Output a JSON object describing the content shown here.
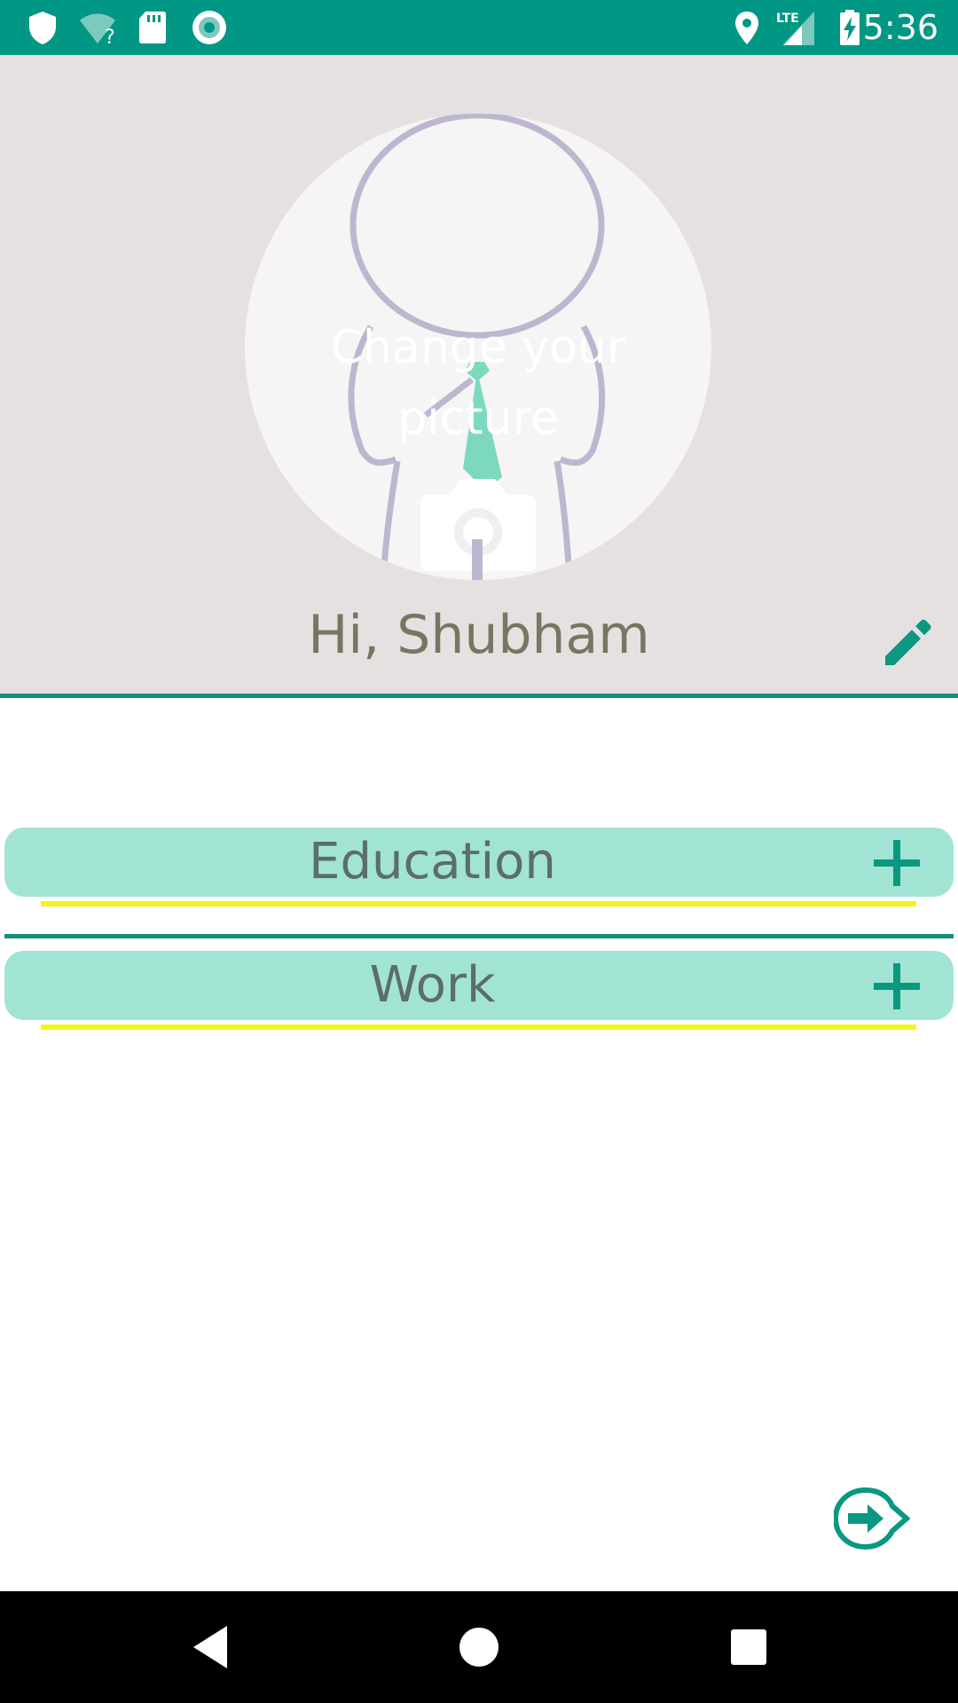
{
  "status_bar": {
    "time": "5:36",
    "icons": [
      "shield-icon",
      "wifi-unknown-icon",
      "sd-card-icon",
      "sync-circle-icon",
      "location-icon",
      "lte-signal-icon",
      "battery-charging-icon"
    ],
    "network_label": "LTE"
  },
  "profile": {
    "change_picture_label": "Change your picture",
    "greeting": "Hi, Shubham",
    "edit_icon": "pencil-icon"
  },
  "sections": [
    {
      "label": "Education",
      "action_icon": "plus-icon"
    },
    {
      "label": "Work",
      "action_icon": "plus-icon"
    }
  ],
  "footer": {
    "next_icon": "arrow-right-circle-icon"
  },
  "nav_bar": {
    "icons": [
      "back-icon",
      "home-icon",
      "recents-icon"
    ]
  },
  "colors": {
    "primary": "#009784",
    "header_bg": "#e6e1e1",
    "section_bg": "#a2e4d4",
    "underline": "#f1f51f",
    "greeting_text": "#7a7562"
  }
}
